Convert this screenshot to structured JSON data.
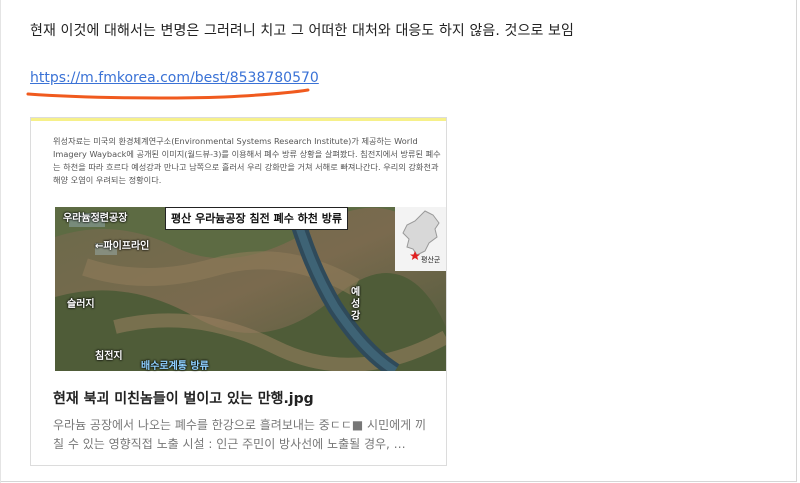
{
  "post": {
    "intro_text": "현재 이것에 대해서는 변명은 그러려니 치고 그 어떠한 대처와 대응도 하지 않음. 것으로 보임",
    "link_text": "https://m.fmkorea.com/best/8538780570"
  },
  "card": {
    "article_text": "위성자료는 미국의 환경체계연구소(Environmental Systems Research Institute)가 제공하는 World Imagery Wayback에 공개된 이미지(월드뷰-3)를 이용해서 폐수 방류 상황을 살펴봤다. 침전지에서 방류된 폐수는 하천을 따라 흐르다 예성강과 만나고 남쪽으로 흘러서 우리 강화만을 거쳐 서해로 빠져나간다. 우리의 강화천과 해양 오염이 우려되는 정황이다.",
    "image_title": "평산 우라늄공장 침전 폐수 하천 방류",
    "labels": {
      "factory": "우라늄정련공장",
      "pipeline": "←파이프라인",
      "sludge": "슬러지",
      "settling": "침전지",
      "drain": "배수로계통 방류",
      "river": "예성강",
      "county": "평산군"
    },
    "title": "현재 북괴 미친놈들이 벌이고 있는 만행.jpg",
    "description": "우라늄 공장에서 나오는 폐수를 한강으로 흘려보내는 중ㄷㄷ■ 시민에게 끼칠 수 있는 영향직접 노출 시설 : 인근 주민이 방사선에 노출될 경우, …"
  },
  "colors": {
    "link": "#3a72d6",
    "annotation_underline": "#f05a1e",
    "highlight": "#f6f08a"
  }
}
